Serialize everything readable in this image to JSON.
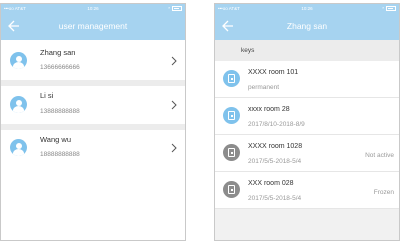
{
  "status_bar": {
    "carrier": "•••oo AT&T",
    "time": "10:26",
    "bluetooth": "*"
  },
  "screen1": {
    "title": "user management",
    "users": [
      {
        "name": "Zhang san",
        "phone": "13666666666"
      },
      {
        "name": "Li si",
        "phone": "13888888888"
      },
      {
        "name": "Wang wu",
        "phone": "18888888888"
      }
    ]
  },
  "screen2": {
    "title": "Zhang san",
    "section_label": "keys",
    "keys": [
      {
        "name": "XXXX room 101",
        "sub": "permanent",
        "status": "",
        "icon_color": "blue"
      },
      {
        "name": "xxxx room 28",
        "sub": "2017/8/10-2018-8/9",
        "status": "",
        "icon_color": "blue"
      },
      {
        "name": "XXXX room 1028",
        "sub": "2017/5/5-2018-5/4",
        "status": "Not active",
        "icon_color": "gray"
      },
      {
        "name": "XXX room 028",
        "sub": "2017/5/5-2018-5/4",
        "status": "Frozen",
        "icon_color": "gray"
      }
    ]
  },
  "colors": {
    "accent": "#a6d3f0",
    "avatar": "#7fc2ec",
    "inactive": "#8c8c8c"
  }
}
